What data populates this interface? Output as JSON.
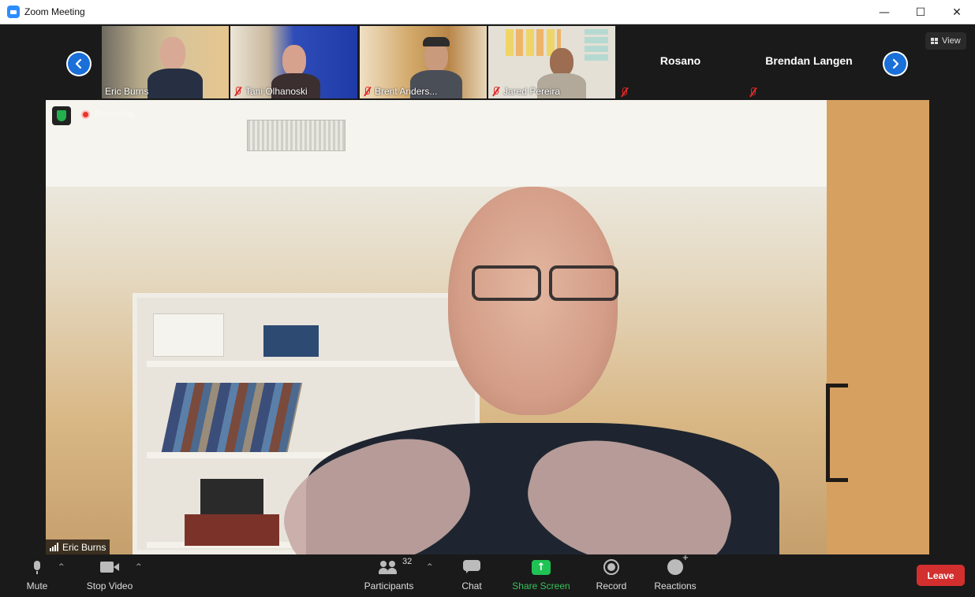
{
  "window": {
    "title": "Zoom Meeting",
    "minimize": "—",
    "maximize": "☐",
    "close": "✕"
  },
  "top": {
    "view_label": "View"
  },
  "gallery": [
    {
      "name": "Eric Burns",
      "muted": false,
      "bg": "#c6a77a"
    },
    {
      "name": "Tani Olhanoski",
      "muted": true,
      "bg": "#3a55b8"
    },
    {
      "name": "Brent Anders...",
      "muted": true,
      "bg": "#b7874f"
    },
    {
      "name": "Jared Pereira",
      "muted": true,
      "bg": "#d9d5c9"
    },
    {
      "name": "Rosano",
      "muted": true,
      "bg": "#1a1a1a"
    },
    {
      "name": "Brendan Langen",
      "muted": true,
      "bg": "#1a1a1a"
    }
  ],
  "speaker": {
    "name": "Eric Burns",
    "recording_label": "Recording..."
  },
  "toolbar": {
    "mute": "Mute",
    "stop_video": "Stop Video",
    "participants": "Participants",
    "participants_count": "32",
    "chat": "Chat",
    "share_screen": "Share Screen",
    "record": "Record",
    "reactions": "Reactions",
    "leave": "Leave"
  },
  "colors": {
    "accent_blue": "#1a6fd8",
    "share_green": "#1fc254",
    "leave_red": "#d32f2f",
    "active_outline": "#a9e33b"
  }
}
